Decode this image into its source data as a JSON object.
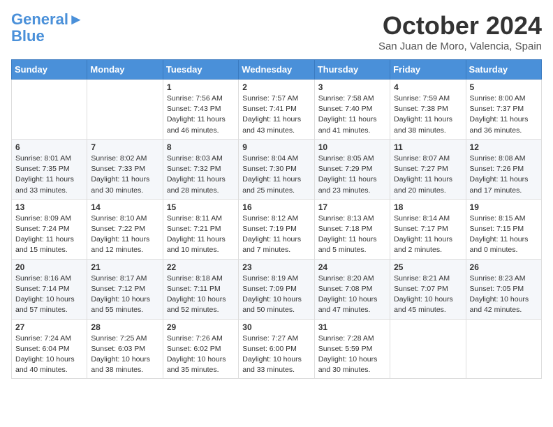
{
  "header": {
    "logo_line1": "General",
    "logo_line2": "Blue",
    "month": "October 2024",
    "location": "San Juan de Moro, Valencia, Spain"
  },
  "weekdays": [
    "Sunday",
    "Monday",
    "Tuesday",
    "Wednesday",
    "Thursday",
    "Friday",
    "Saturday"
  ],
  "weeks": [
    [
      {
        "day": "",
        "info": ""
      },
      {
        "day": "",
        "info": ""
      },
      {
        "day": "1",
        "info": "Sunrise: 7:56 AM\nSunset: 7:43 PM\nDaylight: 11 hours and 46 minutes."
      },
      {
        "day": "2",
        "info": "Sunrise: 7:57 AM\nSunset: 7:41 PM\nDaylight: 11 hours and 43 minutes."
      },
      {
        "day": "3",
        "info": "Sunrise: 7:58 AM\nSunset: 7:40 PM\nDaylight: 11 hours and 41 minutes."
      },
      {
        "day": "4",
        "info": "Sunrise: 7:59 AM\nSunset: 7:38 PM\nDaylight: 11 hours and 38 minutes."
      },
      {
        "day": "5",
        "info": "Sunrise: 8:00 AM\nSunset: 7:37 PM\nDaylight: 11 hours and 36 minutes."
      }
    ],
    [
      {
        "day": "6",
        "info": "Sunrise: 8:01 AM\nSunset: 7:35 PM\nDaylight: 11 hours and 33 minutes."
      },
      {
        "day": "7",
        "info": "Sunrise: 8:02 AM\nSunset: 7:33 PM\nDaylight: 11 hours and 30 minutes."
      },
      {
        "day": "8",
        "info": "Sunrise: 8:03 AM\nSunset: 7:32 PM\nDaylight: 11 hours and 28 minutes."
      },
      {
        "day": "9",
        "info": "Sunrise: 8:04 AM\nSunset: 7:30 PM\nDaylight: 11 hours and 25 minutes."
      },
      {
        "day": "10",
        "info": "Sunrise: 8:05 AM\nSunset: 7:29 PM\nDaylight: 11 hours and 23 minutes."
      },
      {
        "day": "11",
        "info": "Sunrise: 8:07 AM\nSunset: 7:27 PM\nDaylight: 11 hours and 20 minutes."
      },
      {
        "day": "12",
        "info": "Sunrise: 8:08 AM\nSunset: 7:26 PM\nDaylight: 11 hours and 17 minutes."
      }
    ],
    [
      {
        "day": "13",
        "info": "Sunrise: 8:09 AM\nSunset: 7:24 PM\nDaylight: 11 hours and 15 minutes."
      },
      {
        "day": "14",
        "info": "Sunrise: 8:10 AM\nSunset: 7:22 PM\nDaylight: 11 hours and 12 minutes."
      },
      {
        "day": "15",
        "info": "Sunrise: 8:11 AM\nSunset: 7:21 PM\nDaylight: 11 hours and 10 minutes."
      },
      {
        "day": "16",
        "info": "Sunrise: 8:12 AM\nSunset: 7:19 PM\nDaylight: 11 hours and 7 minutes."
      },
      {
        "day": "17",
        "info": "Sunrise: 8:13 AM\nSunset: 7:18 PM\nDaylight: 11 hours and 5 minutes."
      },
      {
        "day": "18",
        "info": "Sunrise: 8:14 AM\nSunset: 7:17 PM\nDaylight: 11 hours and 2 minutes."
      },
      {
        "day": "19",
        "info": "Sunrise: 8:15 AM\nSunset: 7:15 PM\nDaylight: 11 hours and 0 minutes."
      }
    ],
    [
      {
        "day": "20",
        "info": "Sunrise: 8:16 AM\nSunset: 7:14 PM\nDaylight: 10 hours and 57 minutes."
      },
      {
        "day": "21",
        "info": "Sunrise: 8:17 AM\nSunset: 7:12 PM\nDaylight: 10 hours and 55 minutes."
      },
      {
        "day": "22",
        "info": "Sunrise: 8:18 AM\nSunset: 7:11 PM\nDaylight: 10 hours and 52 minutes."
      },
      {
        "day": "23",
        "info": "Sunrise: 8:19 AM\nSunset: 7:09 PM\nDaylight: 10 hours and 50 minutes."
      },
      {
        "day": "24",
        "info": "Sunrise: 8:20 AM\nSunset: 7:08 PM\nDaylight: 10 hours and 47 minutes."
      },
      {
        "day": "25",
        "info": "Sunrise: 8:21 AM\nSunset: 7:07 PM\nDaylight: 10 hours and 45 minutes."
      },
      {
        "day": "26",
        "info": "Sunrise: 8:23 AM\nSunset: 7:05 PM\nDaylight: 10 hours and 42 minutes."
      }
    ],
    [
      {
        "day": "27",
        "info": "Sunrise: 7:24 AM\nSunset: 6:04 PM\nDaylight: 10 hours and 40 minutes."
      },
      {
        "day": "28",
        "info": "Sunrise: 7:25 AM\nSunset: 6:03 PM\nDaylight: 10 hours and 38 minutes."
      },
      {
        "day": "29",
        "info": "Sunrise: 7:26 AM\nSunset: 6:02 PM\nDaylight: 10 hours and 35 minutes."
      },
      {
        "day": "30",
        "info": "Sunrise: 7:27 AM\nSunset: 6:00 PM\nDaylight: 10 hours and 33 minutes."
      },
      {
        "day": "31",
        "info": "Sunrise: 7:28 AM\nSunset: 5:59 PM\nDaylight: 10 hours and 30 minutes."
      },
      {
        "day": "",
        "info": ""
      },
      {
        "day": "",
        "info": ""
      }
    ]
  ]
}
